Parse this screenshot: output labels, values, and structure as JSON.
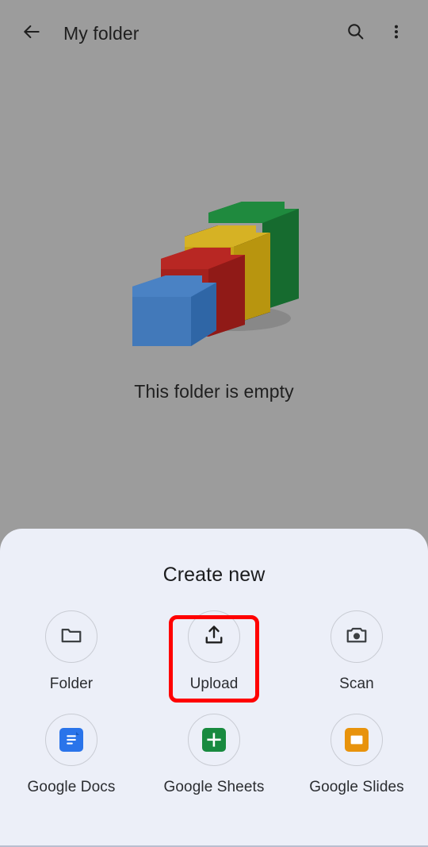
{
  "appbar": {
    "back_icon": "arrow-back-icon",
    "title": "My folder",
    "search_icon": "search-icon",
    "overflow_icon": "more-vert-icon"
  },
  "empty_state": {
    "illustration": "empty-folders-illustration",
    "message": "This folder is empty",
    "illustration_colors": {
      "blue": "#3a74b8",
      "red": "#a8201c",
      "yellow": "#cca619",
      "green": "#1b7a37"
    }
  },
  "sheet": {
    "title": "Create new",
    "background": "#eceff8",
    "items": [
      {
        "id": "folder",
        "label": "Folder",
        "icon": "folder-icon",
        "icon_color": "#3c4043",
        "style": "outline"
      },
      {
        "id": "upload",
        "label": "Upload",
        "icon": "upload-icon",
        "icon_color": "#1f1f1f",
        "style": "outline"
      },
      {
        "id": "scan",
        "label": "Scan",
        "icon": "camera-icon",
        "icon_color": "#3c4043",
        "style": "outline"
      },
      {
        "id": "google-docs",
        "label": "Google Docs",
        "icon": "google-docs-icon",
        "icon_color": "#2a74ea",
        "style": "tile"
      },
      {
        "id": "google-sheets",
        "label": "Google Sheets",
        "icon": "google-sheets-icon",
        "icon_color": "#188a3f",
        "style": "tile"
      },
      {
        "id": "google-slides",
        "label": "Google Slides",
        "icon": "google-slides-icon",
        "icon_color": "#e8930c",
        "style": "tile"
      }
    ]
  },
  "annotation": {
    "target": "upload",
    "color": "#ff0000",
    "shape": "rounded-rectangle"
  }
}
